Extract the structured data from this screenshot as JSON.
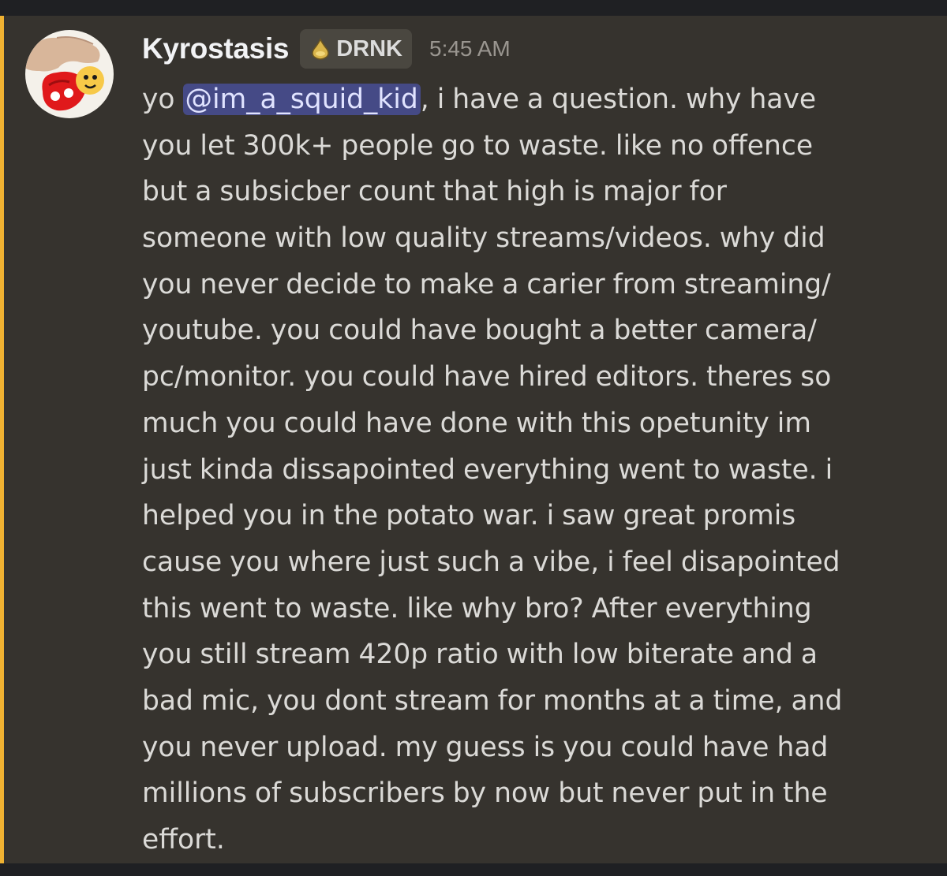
{
  "message": {
    "author": "Kyrostasis",
    "guild_tag": "DRNK",
    "timestamp": "5:45 AM",
    "mention": "@im_a_squid_kid",
    "line1_before": "yo ",
    "line1_after": ", i have a question. why have",
    "lines": [
      "you let 300k+ people go to waste. like no offence",
      "but a subsicber count that high is major for",
      "someone with low quality streams/videos. why did",
      "you never decide to make a carier from streaming/",
      "youtube. you could have bought a better camera/",
      "pc/monitor. you could have hired editors. theres so",
      "much you could have done with this opetunity im",
      "just kinda dissapointed everything went to waste. i",
      "helped you in the potato war. i saw great promis",
      "cause you where just such a vibe, i feel disapointed",
      "this went to waste. like why bro? After everything",
      "you still stream 420p ratio with low biterate and a",
      "bad mic, you dont stream for months at a time, and",
      "you never upload. my guess is you could have had",
      "millions of subscribers by now but never put in the",
      "effort."
    ]
  },
  "colors": {
    "background": "#36332e",
    "mention_bar": "#f0b232",
    "mention_highlight": "#5865f2",
    "text": "#dbdad7"
  },
  "icons": {
    "guild_tag_icon": "drink-drop-icon"
  }
}
